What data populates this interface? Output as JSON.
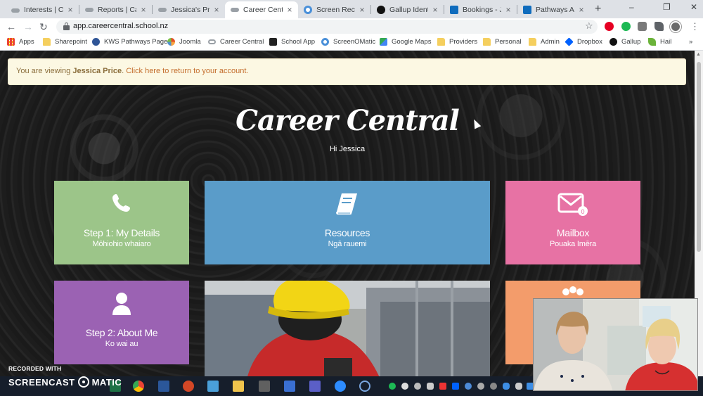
{
  "browser": {
    "tabs": [
      {
        "label": "Interests | Care",
        "color": "#9aa0a6"
      },
      {
        "label": "Reports | Care",
        "color": "#9aa0a6"
      },
      {
        "label": "Jessica's Profil",
        "color": "#9aa0a6"
      },
      {
        "label": "Career Central",
        "color": "#9aa0a6"
      },
      {
        "label": "Screen Record",
        "color": "#4a90d9"
      },
      {
        "label": "Gallup Identity",
        "color": "#111111"
      },
      {
        "label": "Bookings - Jes",
        "color": "#0f6cbd"
      },
      {
        "label": "Pathways Appl",
        "color": "#0f6cbd"
      }
    ],
    "active_tab_index": 3,
    "new_tab_glyph": "+",
    "close_glyph": "×",
    "window_controls": [
      "–",
      "❐",
      "✕"
    ],
    "url": "app.careercentral.school.nz",
    "bookmarks": [
      {
        "label": "Apps",
        "icon": "apps-grid-icon",
        "color": "#ea4335"
      },
      {
        "label": "Sharepoint",
        "icon": "folder-icon",
        "color": "#f5cf5e"
      },
      {
        "label": "KWS Pathways Page",
        "icon": "wave-icon",
        "color": "#2f5597"
      },
      {
        "label": "Joomla",
        "icon": "joomla-icon",
        "color": "#e44d26"
      },
      {
        "label": "Career Central",
        "icon": "link-icon",
        "color": "#9aa0a6"
      },
      {
        "label": "School App",
        "icon": "school-app-icon",
        "color": "#222222"
      },
      {
        "label": "ScreenOMatic",
        "icon": "screenomatic-icon",
        "color": "#4a90d9"
      },
      {
        "label": "Google Maps",
        "icon": "map-icon",
        "color": "#34a853"
      },
      {
        "label": "Providers",
        "icon": "folder-icon",
        "color": "#f5cf5e"
      },
      {
        "label": "Personal",
        "icon": "folder-icon",
        "color": "#f5cf5e"
      },
      {
        "label": "Admin",
        "icon": "folder-icon",
        "color": "#f5cf5e"
      },
      {
        "label": "Dropbox",
        "icon": "dropbox-icon",
        "color": "#0061fe"
      },
      {
        "label": "Gallup",
        "icon": "gallup-icon",
        "color": "#111111"
      },
      {
        "label": "Hail",
        "icon": "hail-icon",
        "color": "#6bb33a"
      }
    ],
    "bookmarks_overflow": "»"
  },
  "page": {
    "notice": {
      "prefix": "You are viewing ",
      "user": "Jessica Price",
      "link": "Click here to return to your account."
    },
    "title": "Career Central",
    "greeting": "Hi Jessica",
    "tiles": [
      {
        "title": "Step 1: My Details",
        "subtitle": "Mōhiohio whaiaro",
        "color": "#9cc589",
        "icon": "phone-icon"
      },
      {
        "title": "Resources",
        "subtitle": "Ngā rauemi",
        "color": "#5a9cc9",
        "icon": "book-icon"
      },
      {
        "title": "Mailbox",
        "subtitle": "Pouaka Imēra",
        "color": "#e772a4",
        "icon": "envelope-icon",
        "badge": "0"
      },
      {
        "title": "Step 2: About Me",
        "subtitle": "Ko wai au",
        "color": "#9b62b3",
        "icon": "user-icon"
      },
      {
        "title": "",
        "subtitle": "",
        "color": "#f39c6b",
        "icon": "group-icon"
      }
    ]
  },
  "overlay": {
    "recorded_with": "RECORDED WITH",
    "brand_left": "SCREENCAST",
    "brand_right": "MATIC"
  }
}
